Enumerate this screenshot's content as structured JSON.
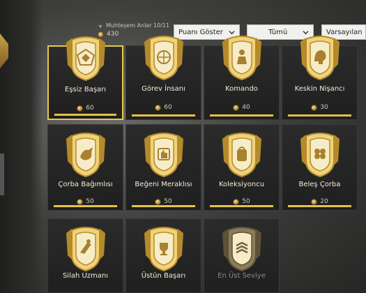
{
  "header": {
    "title": "Muhteşem Anlar 10/11",
    "points": "430"
  },
  "filters": {
    "show_points": "Puanı Göster",
    "category": "Tümü",
    "sort": "Varsayılan"
  },
  "achievements": [
    {
      "name": "Eşsiz Başarı",
      "points": "60",
      "icon": "crest-icon"
    },
    {
      "name": "Görev İnsanı",
      "points": "60",
      "icon": "crosshair-gun-icon"
    },
    {
      "name": "Komando",
      "points": "40",
      "icon": "soldier-icon"
    },
    {
      "name": "Keskin Nişancı",
      "points": "30",
      "icon": "helmet-icon"
    },
    {
      "name": "Çorba Bağımlısı",
      "points": "50",
      "icon": "chicken-icon"
    },
    {
      "name": "Beğeni Meraklısı",
      "points": "50",
      "icon": "thumbs-up-icon"
    },
    {
      "name": "Koleksiyoncu",
      "points": "50",
      "icon": "backpack-icon"
    },
    {
      "name": "Beleş Çorba",
      "points": "20",
      "icon": "clover-icon"
    },
    {
      "name": "Silah Uzmanı",
      "points": "",
      "icon": "gunner-icon"
    },
    {
      "name": "Üstün Başarı",
      "points": "",
      "icon": "trophy-icon"
    },
    {
      "name": "En Üst Seviye",
      "points": "",
      "icon": "rank-chevron-icon"
    }
  ],
  "colors": {
    "gold": "#e2c24a",
    "card": "#262626",
    "dropdown": "#f1f1ef"
  }
}
